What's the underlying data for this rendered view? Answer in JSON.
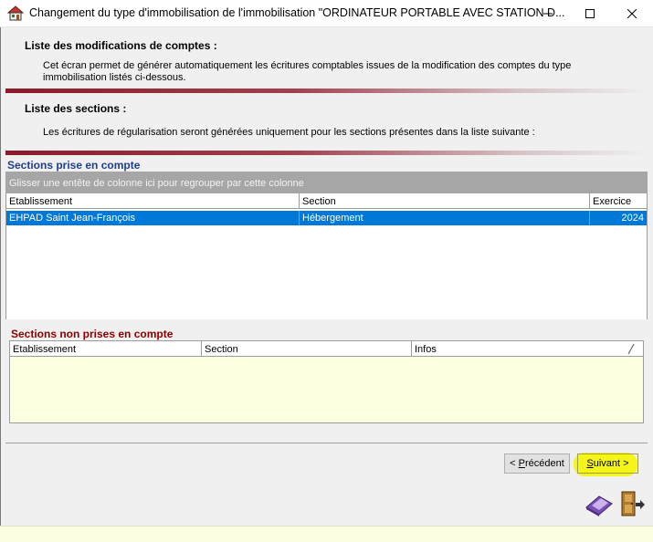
{
  "window": {
    "title": "Changement du type d'immobilisation de l'immobilisation \"ORDINATEUR PORTABLE AVEC STATION D...",
    "minimize": "minimize",
    "maximize": "maximize",
    "close": "close"
  },
  "accounts_section": {
    "heading": "Liste des modifications de comptes :",
    "line1": "Cet écran permet de générer automatiquement les écritures comptables issues de la modification des comptes du type",
    "line2": "immobilisation listés ci-dessous."
  },
  "sections_section": {
    "heading": "Liste des sections :",
    "text": "Les écritures de régularisation seront générées uniquement pour les sections présentes dans la liste suivante :"
  },
  "included_grid": {
    "title": "Sections prise en compte",
    "group_hint": "Glisser une entête de colonne ici pour regrouper par cette colonne",
    "columns": [
      "Etablissement",
      "Section",
      "Exercice"
    ],
    "rows": [
      {
        "etablissement": "EHPAD Saint Jean-François",
        "section": "Hébergement",
        "exercice": "2024"
      }
    ]
  },
  "excluded_grid": {
    "title": "Sections non prises en compte",
    "columns": [
      "Etablissement",
      "Section",
      "Infos"
    ]
  },
  "buttons": {
    "previous_mnemonic": "P",
    "previous_prefix": "< ",
    "previous_rest": "récédent",
    "next_mnemonic": "S",
    "next_rest": "uivant >"
  },
  "colors": {
    "selection": "#0078d7",
    "separator": "#8b1a2b",
    "included_title": "#1f3f8c",
    "excluded_title": "#8b0000",
    "highlight": "#f5f500"
  },
  "icons": {
    "app": "house-app-icon",
    "tools": "eraser-tool-icon",
    "exit": "exit-door-icon"
  }
}
